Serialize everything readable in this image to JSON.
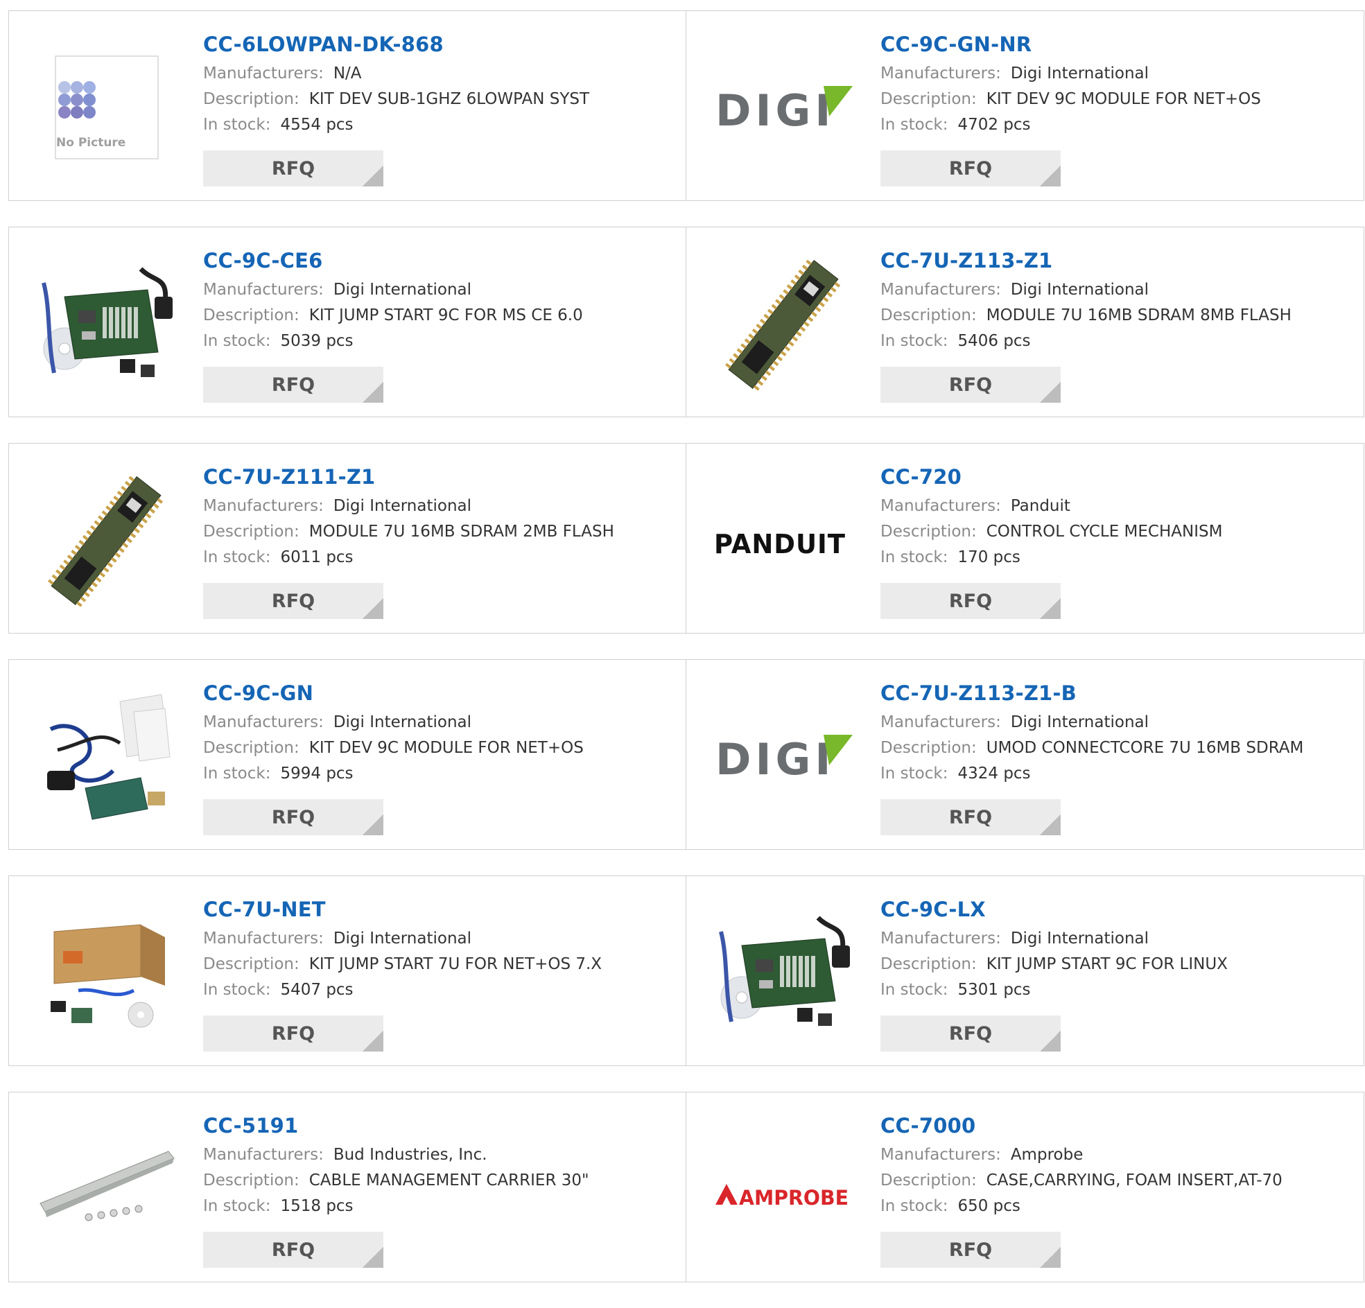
{
  "labels": {
    "manufacturers": "Manufacturers:",
    "description": "Description:",
    "in_stock": "In stock:",
    "rfq": "RFQ",
    "no_picture": "No Picture"
  },
  "products": [
    {
      "part": "CC-6LOWPAN-DK-868",
      "manufacturer": "N/A",
      "description": "KIT DEV SUB-1GHZ 6LOWPAN SYST",
      "stock": "4554 pcs",
      "image": "no-picture-placeholder"
    },
    {
      "part": "CC-9C-GN-NR",
      "manufacturer": "Digi International",
      "description": "KIT DEV 9C MODULE FOR NET+OS",
      "stock": "4702 pcs",
      "image": "digi-logo"
    },
    {
      "part": "CC-9C-CE6",
      "manufacturer": "Digi International",
      "description": "KIT JUMP START 9C FOR MS CE 6.0",
      "stock": "5039 pcs",
      "image": "dev-kit-photo"
    },
    {
      "part": "CC-7U-Z113-Z1",
      "manufacturer": "Digi International",
      "description": "MODULE 7U 16MB SDRAM 8MB FLASH",
      "stock": "5406 pcs",
      "image": "module-photo"
    },
    {
      "part": "CC-7U-Z111-Z1",
      "manufacturer": "Digi International",
      "description": "MODULE 7U 16MB SDRAM 2MB FLASH",
      "stock": "6011 pcs",
      "image": "module-photo"
    },
    {
      "part": "CC-720",
      "manufacturer": "Panduit",
      "description": "CONTROL CYCLE MECHANISM",
      "stock": "170 pcs",
      "image": "panduit-logo"
    },
    {
      "part": "CC-9C-GN",
      "manufacturer": "Digi International",
      "description": "KIT DEV 9C MODULE FOR NET+OS",
      "stock": "5994 pcs",
      "image": "dev-kit-cables-photo"
    },
    {
      "part": "CC-7U-Z113-Z1-B",
      "manufacturer": "Digi International",
      "description": "UMOD CONNECTCORE 7U 16MB SDRAM",
      "stock": "4324 pcs",
      "image": "digi-logo"
    },
    {
      "part": "CC-7U-NET",
      "manufacturer": "Digi International",
      "description": "KIT JUMP START 7U FOR NET+OS 7.X",
      "stock": "5407 pcs",
      "image": "boxed-kit-photo"
    },
    {
      "part": "CC-9C-LX",
      "manufacturer": "Digi International",
      "description": "KIT JUMP START 9C FOR LINUX",
      "stock": "5301 pcs",
      "image": "dev-kit-photo"
    },
    {
      "part": "CC-5191",
      "manufacturer": "Bud Industries, Inc.",
      "description": "CABLE MANAGEMENT CARRIER 30\"",
      "stock": "1518 pcs",
      "image": "rail-photo"
    },
    {
      "part": "CC-7000",
      "manufacturer": "Amprobe",
      "description": "CASE,CARRYING, FOAM INSERT,AT-70",
      "stock": "650 pcs",
      "image": "amprobe-logo"
    }
  ],
  "logos": {
    "digi": "DIGI",
    "panduit": "PANDUIT",
    "amprobe": "AMPROBE"
  },
  "colors": {
    "link": "#1565b5",
    "label": "#8a8a8a",
    "value": "#333333",
    "button_bg": "#ebebeb",
    "border": "#cfcfcf"
  }
}
